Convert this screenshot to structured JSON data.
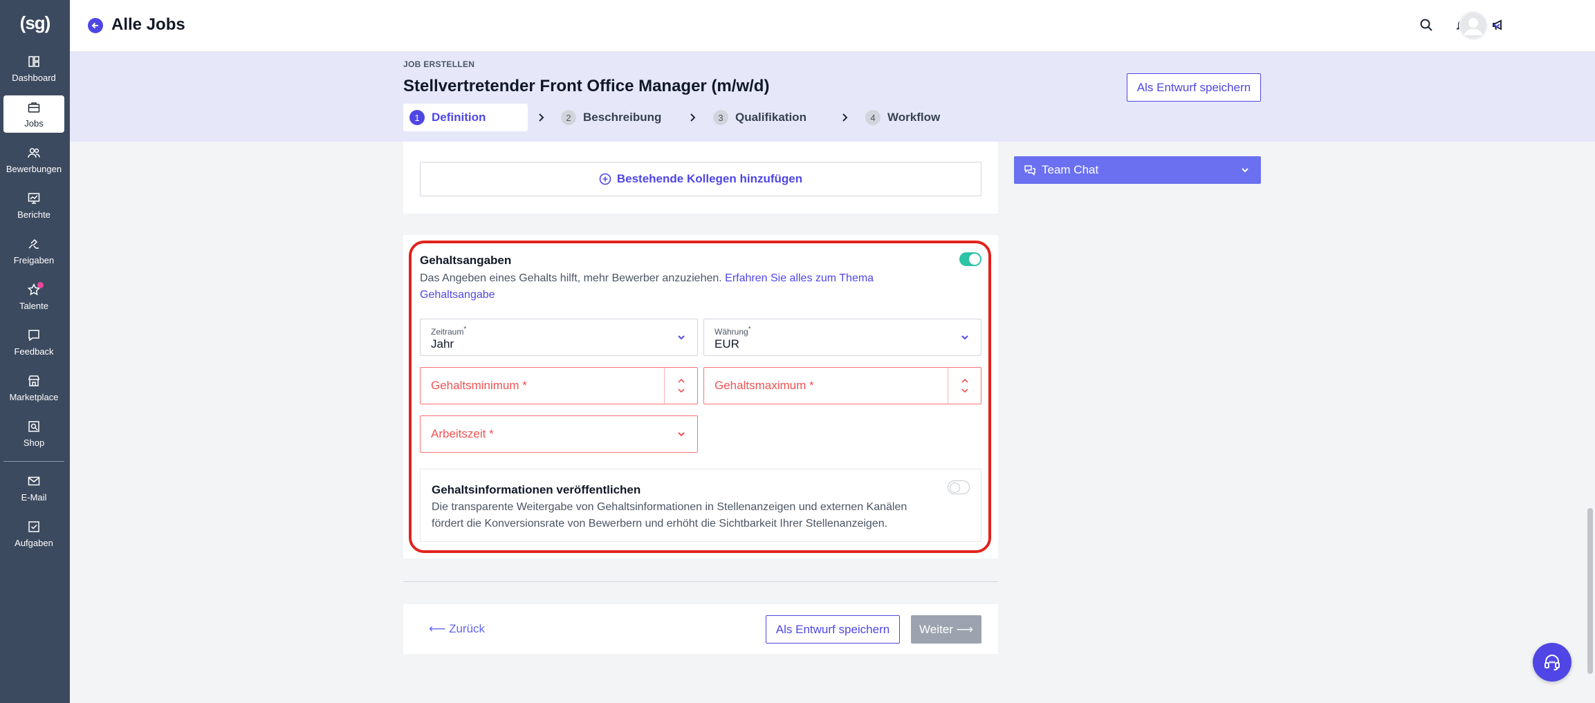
{
  "sidebar": {
    "logo": "(sg)",
    "items": [
      {
        "label": "Dashboard",
        "icon": "dashboard-icon"
      },
      {
        "label": "Jobs",
        "icon": "briefcase-icon"
      },
      {
        "label": "Bewerbungen",
        "icon": "users-icon"
      },
      {
        "label": "Berichte",
        "icon": "chart-icon"
      },
      {
        "label": "Freigaben",
        "icon": "approval-hand-icon"
      },
      {
        "label": "Talente",
        "icon": "star-icon"
      },
      {
        "label": "Feedback",
        "icon": "feedback-icon"
      },
      {
        "label": "Marketplace",
        "icon": "store-icon"
      },
      {
        "label": "Shop",
        "icon": "shop-search-icon"
      },
      {
        "label": "E-Mail",
        "icon": "mail-icon"
      },
      {
        "label": "Aufgaben",
        "icon": "checkbox-icon"
      }
    ]
  },
  "topbar": {
    "title": "Alle Jobs"
  },
  "header": {
    "overline": "JOB ERSTELLEN",
    "job_title": "Stellvertretender Front Office Manager (m/w/d)",
    "draft_button": "Als Entwurf speichern",
    "steps": [
      {
        "num": "1",
        "label": "Definition"
      },
      {
        "num": "2",
        "label": "Beschreibung"
      },
      {
        "num": "3",
        "label": "Qualifikation"
      },
      {
        "num": "4",
        "label": "Workflow"
      }
    ]
  },
  "colleagues": {
    "add_button": "Bestehende Kollegen hinzufügen"
  },
  "team_chat": {
    "label": "Team Chat"
  },
  "salary": {
    "title": "Gehaltsangaben",
    "description": "Das Angeben eines Gehalts hilft, mehr Bewerber anzuziehen.",
    "link": "Erfahren Sie alles zum Thema Gehaltsangabe",
    "enabled": true,
    "period": {
      "label": "Zeitraum",
      "required_mark": "*",
      "value": "Jahr"
    },
    "currency": {
      "label": "Währung",
      "required_mark": "*",
      "value": "EUR"
    },
    "min_placeholder": "Gehaltsminimum *",
    "max_placeholder": "Gehaltsmaximum *",
    "worktime_placeholder": "Arbeitszeit *",
    "publish": {
      "title": "Gehaltsinformationen veröffentlichen",
      "description": "Die transparente Weitergabe von Gehaltsinformationen in Stellenanzeigen und externen Kanälen fördert die Konversionsrate von Bewerbern und erhöht die Sichtbarkeit Ihrer Stellenanzeigen.",
      "enabled": false
    }
  },
  "footer": {
    "back": "⟵ Zurück",
    "draft": "Als Entwurf speichern",
    "next": "Weiter ⟶"
  },
  "colors": {
    "accent": "#4f46e5",
    "sidebar": "#3c4a5f",
    "error": "#e0231c",
    "toggle_on": "#2dc3a6"
  }
}
